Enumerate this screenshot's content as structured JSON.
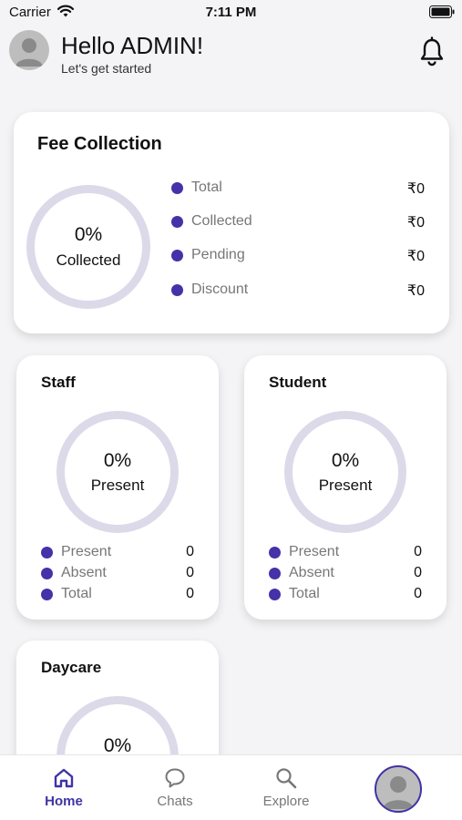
{
  "status_bar": {
    "carrier": "Carrier",
    "time": "7:11 PM"
  },
  "header": {
    "title": "Hello ADMIN!",
    "subtitle": "Let's get started"
  },
  "colors": {
    "accent": "#4432a8",
    "ring": "#dcdae9",
    "background": "#f4f4f6"
  },
  "fee_collection": {
    "title": "Fee Collection",
    "percent": "0%",
    "ring_label": "Collected",
    "rows": [
      {
        "label": "Total",
        "value": "₹0"
      },
      {
        "label": "Collected",
        "value": "₹0"
      },
      {
        "label": "Pending",
        "value": "₹0"
      },
      {
        "label": "Discount",
        "value": "₹0"
      }
    ]
  },
  "staff": {
    "title": "Staff",
    "percent": "0%",
    "ring_label": "Present",
    "rows": [
      {
        "label": "Present",
        "value": "0"
      },
      {
        "label": "Absent",
        "value": "0"
      },
      {
        "label": "Total",
        "value": "0"
      }
    ]
  },
  "student": {
    "title": "Student",
    "percent": "0%",
    "ring_label": "Present",
    "rows": [
      {
        "label": "Present",
        "value": "0"
      },
      {
        "label": "Absent",
        "value": "0"
      },
      {
        "label": "Total",
        "value": "0"
      }
    ]
  },
  "daycare": {
    "title": "Daycare",
    "percent": "0%"
  },
  "bottom_nav": {
    "items": [
      {
        "label": "Home",
        "icon": "home-icon",
        "active": true
      },
      {
        "label": "Chats",
        "icon": "chat-icon",
        "active": false
      },
      {
        "label": "Explore",
        "icon": "search-icon",
        "active": false
      }
    ]
  }
}
